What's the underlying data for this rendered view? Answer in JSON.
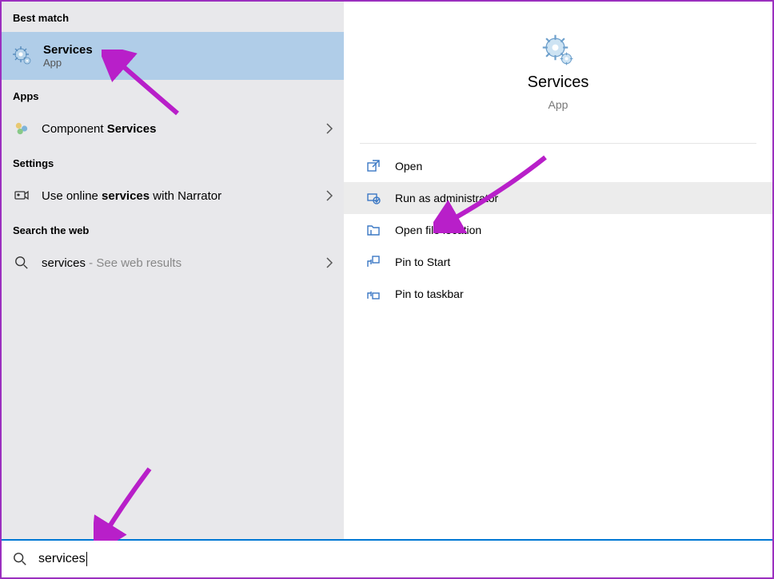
{
  "left": {
    "bestMatchHeader": "Best match",
    "bestMatch": {
      "title": "Services",
      "sub": "App"
    },
    "appsHeader": "Apps",
    "apps": [
      {
        "prefix": "Component ",
        "bold": "Services",
        "suffix": ""
      }
    ],
    "settingsHeader": "Settings",
    "settings": [
      {
        "prefix": "Use online ",
        "bold": "services",
        "suffix": " with Narrator"
      }
    ],
    "webHeader": "Search the web",
    "web": [
      {
        "bold": "services",
        "gray": " - See web results"
      }
    ]
  },
  "right": {
    "title": "Services",
    "sub": "App",
    "actions": [
      {
        "label": "Open",
        "icon": "open"
      },
      {
        "label": "Run as administrator",
        "icon": "admin"
      },
      {
        "label": "Open file location",
        "icon": "folder"
      },
      {
        "label": "Pin to Start",
        "icon": "pinstart"
      },
      {
        "label": "Pin to taskbar",
        "icon": "pintaskbar"
      }
    ]
  },
  "search": {
    "value": "services"
  }
}
